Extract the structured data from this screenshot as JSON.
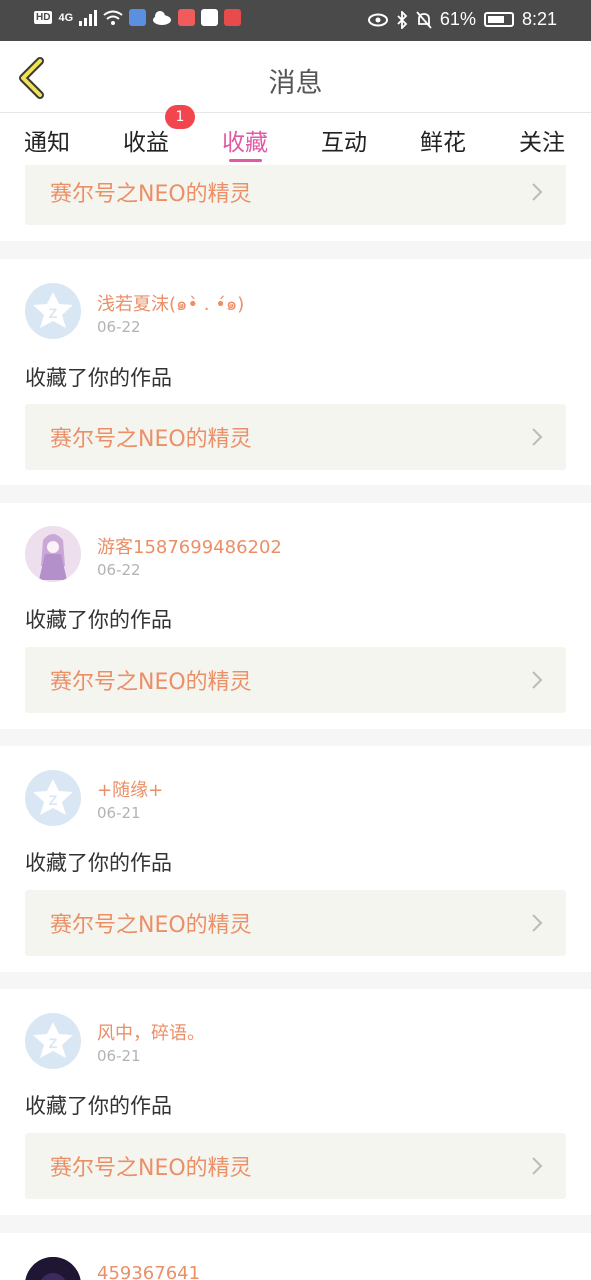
{
  "status_bar": {
    "network_label": "HD",
    "network_type": "4G",
    "battery": "61%",
    "time": "8:21"
  },
  "header": {
    "title": "消息",
    "back_icon": "chevron-left-icon"
  },
  "tabs": [
    {
      "label": "通知",
      "active": false
    },
    {
      "label": "收益",
      "active": false,
      "badge": "1"
    },
    {
      "label": "收藏",
      "active": true
    },
    {
      "label": "互动",
      "active": false
    },
    {
      "label": "鲜花",
      "active": false
    },
    {
      "label": "关注",
      "active": false
    }
  ],
  "colors": {
    "accent": "#e05aa5",
    "name": "#eb8f67",
    "badge": "#f2454e"
  },
  "partial_top_card": {
    "work_title": "赛尔号之NEO的精灵"
  },
  "notifications": [
    {
      "user": "浅若夏沫(๑•̀ . •́๑)",
      "date": "06-22",
      "action": "收藏了你的作品",
      "work_title": "赛尔号之NEO的精灵",
      "avatar": "default"
    },
    {
      "user": "游客1587699486202",
      "date": "06-22",
      "action": "收藏了你的作品",
      "work_title": "赛尔号之NEO的精灵",
      "avatar": "anime"
    },
    {
      "user": "+随缘+",
      "date": "06-21",
      "action": "收藏了你的作品",
      "work_title": "赛尔号之NEO的精灵",
      "avatar": "default"
    },
    {
      "user": "风中，碎语。",
      "date": "06-21",
      "action": "收藏了你的作品",
      "work_title": "赛尔号之NEO的精灵",
      "avatar": "default"
    },
    {
      "user": "459367641",
      "date": "",
      "action": "",
      "work_title": "",
      "avatar": "dark"
    }
  ]
}
